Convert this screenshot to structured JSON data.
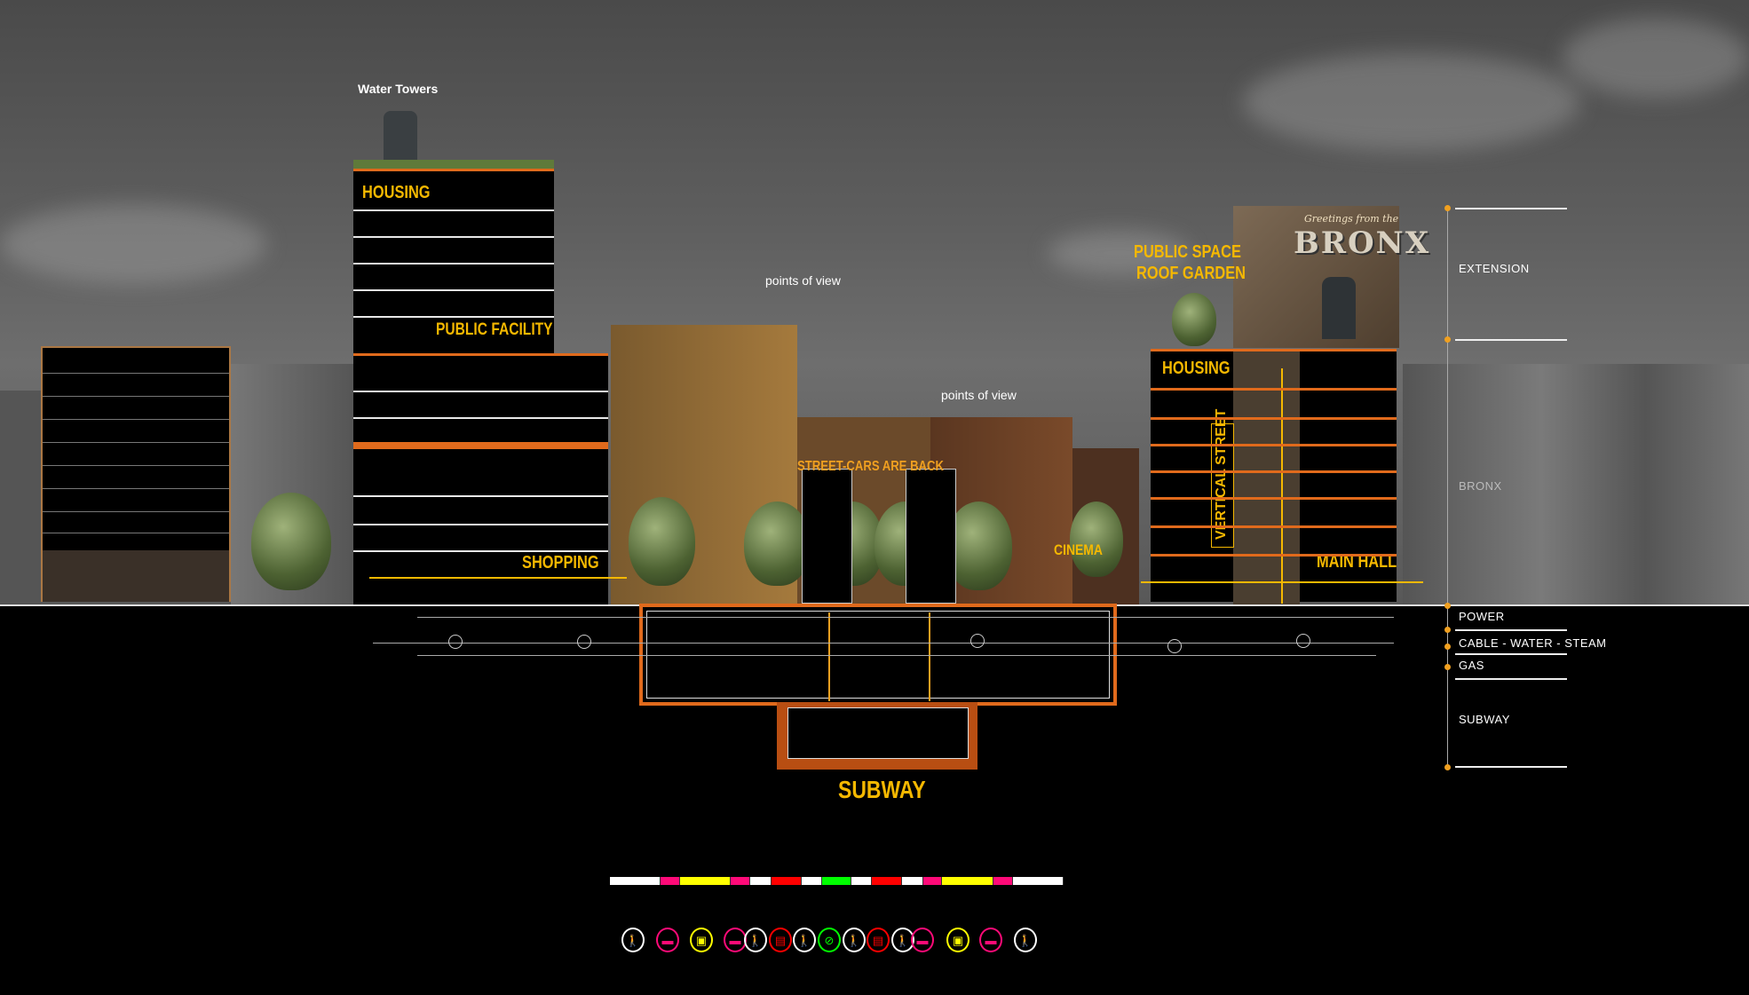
{
  "labels": {
    "water_towers": "Water Towers",
    "housing_left": "HOUSING",
    "public_facility": "PUBLIC FACILITY",
    "points_of_view_1": "points of view",
    "points_of_view_2": "points of view",
    "shopping": "SHOPPING",
    "street_cars": "STREET-CARS ARE BACK",
    "public_space": "PUBLIC SPACE",
    "roof_garden": "ROOF GARDEN",
    "housing_right": "HOUSING",
    "vertical_street": "VERTICAL STREET",
    "cinema": "CINEMA",
    "main_hall": "MAIN HALL",
    "subway": "SUBWAY",
    "billboard_greeting": "Greetings from the",
    "billboard_name": "BRONX"
  },
  "legend": {
    "items": [
      "EXTENSION",
      "BRONX",
      "POWER",
      "CABLE - WATER - STEAM",
      "GAS",
      "SUBWAY"
    ]
  },
  "colors": {
    "accent_yellow": "#f5b800",
    "floor_orange": "#e06a1c",
    "white": "#ffffff",
    "pink": "#ff0a78",
    "yellow": "#ffff00",
    "red": "#ff0000",
    "green": "#00ff00"
  },
  "street_bar": {
    "segments": [
      "white",
      "pink",
      "yellow",
      "pink",
      "white",
      "red",
      "white",
      "green",
      "white",
      "red",
      "white",
      "pink",
      "yellow",
      "pink",
      "white"
    ]
  },
  "mode_icons": [
    {
      "mode": "pedestrian-icon",
      "color": "white"
    },
    {
      "mode": "car-icon",
      "color": "pink"
    },
    {
      "mode": "taxi-icon",
      "color": "yellow"
    },
    {
      "mode": "car-icon",
      "color": "pink"
    },
    {
      "mode": "pedestrian-icon",
      "color": "white"
    },
    {
      "mode": "streetcar-icon",
      "color": "red"
    },
    {
      "mode": "pedestrian-icon",
      "color": "white"
    },
    {
      "mode": "bicycle-icon",
      "color": "green"
    },
    {
      "mode": "pedestrian-icon",
      "color": "white"
    },
    {
      "mode": "streetcar-icon",
      "color": "red"
    },
    {
      "mode": "pedestrian-icon",
      "color": "white"
    },
    {
      "mode": "car-icon",
      "color": "pink"
    },
    {
      "mode": "taxi-icon",
      "color": "yellow"
    },
    {
      "mode": "car-icon",
      "color": "pink"
    },
    {
      "mode": "pedestrian-icon",
      "color": "white"
    }
  ]
}
